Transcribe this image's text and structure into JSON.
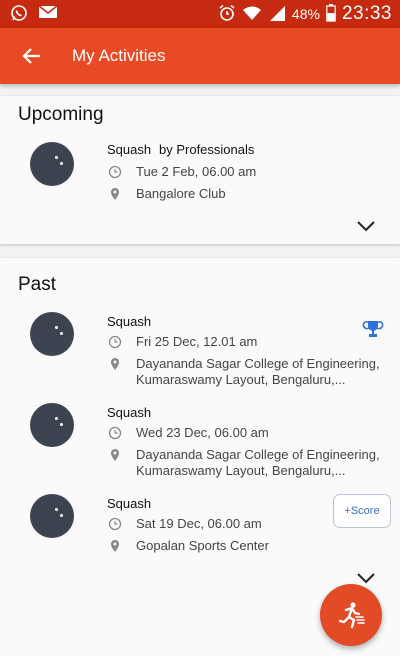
{
  "status_bar": {
    "time": "23:33",
    "battery": "48%",
    "icons": [
      "whatsapp-icon",
      "mail-icon",
      "alarm-icon",
      "wifi-icon",
      "signal-icon",
      "battery-icon"
    ]
  },
  "app_bar": {
    "title": "My Activities",
    "back_icon": "arrow-left-icon",
    "color": "#e84a26"
  },
  "upcoming": {
    "title": "Upcoming",
    "items": [
      {
        "sport": "Squash",
        "by": "by Professionals",
        "datetime": "Tue 2 Feb, 06.00 am",
        "location": "Bangalore Club"
      }
    ]
  },
  "past": {
    "title": "Past",
    "items": [
      {
        "sport": "Squash",
        "datetime": "Fri 25 Dec, 12.01 am",
        "location": "Dayananda Sagar College of Engineering, Kumaraswamy Layout, Bengaluru,...",
        "badge": "trophy-icon"
      },
      {
        "sport": "Squash",
        "datetime": "Wed 23 Dec, 06.00 am",
        "location": "Dayananda Sagar College of Engineering, Kumaraswamy Layout, Bengaluru,..."
      },
      {
        "sport": "Squash",
        "datetime": "Sat 19 Dec, 06.00 am",
        "location": "Gopalan Sports Center",
        "action": "+Score"
      }
    ]
  },
  "fab": {
    "icon": "runner-icon",
    "color": "#e34b27"
  }
}
